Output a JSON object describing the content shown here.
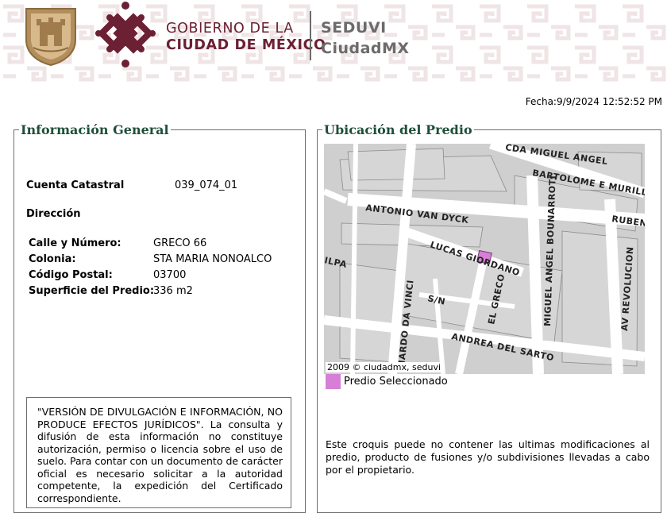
{
  "header": {
    "gobierno_line1": "GOBIERNO DE LA",
    "gobierno_line2": "CIUDAD DE MÉXICO",
    "seduvi_line1": "SEDUVI",
    "seduvi_line2": "CiudadMX",
    "brand_color": "#6b2034",
    "gray_color": "#6b6b6b"
  },
  "fecha": "Fecha:9/9/2024 12:52:52 PM",
  "info": {
    "legend": "Información General",
    "cuenta_label": "Cuenta Catastral",
    "cuenta_value": "039_074_01",
    "direccion_label": "Dirección",
    "calle_label": "Calle y Número:",
    "calle_value": "GRECO 66",
    "colonia_label": "Colonia:",
    "colonia_value": "STA MARIA NONOALCO",
    "cp_label": "Código Postal:",
    "cp_value": "03700",
    "superficie_label": "Superficie del Predio:",
    "superficie_value": "336 m2"
  },
  "disclaimer": "\"VERSIÓN DE DIVULGACIÓN E INFORMACIÓN, NO PRODUCE EFECTOS JURÍDICOS\". La consulta y difusión de esta información no constituye autorización, permiso o licencia sobre el uso de suelo. Para contar con un documento de carácter oficial es necesario solicitar a la autoridad competente, la expedición del Certificado correspondiente.",
  "ubicacion": {
    "legend": "Ubicación del Predio",
    "map_credit": "2009 © ciudadmx, seduvi",
    "predio_label": "Predio Seleccionado",
    "predio_color": "#d77fd6",
    "note": "Este croquis puede no contener las ultimas modificaciones al predio, producto de fusiones y/o subdivisiones llevadas a cabo por el propietario."
  },
  "map": {
    "streets": {
      "s1": "CDA MIGUEL ANGEL",
      "s2": "BARTOLOME E MURILLO",
      "s3": "RUBEN",
      "s4": "ANTONIO VAN DYCK",
      "s5": "LUCAS GIORDANO",
      "s6": "MIGUEL ANGEL BOUNARROTI",
      "s7": "AV REVOLUCION",
      "s8": "ILPA",
      "s9": "S/N",
      "s10": "NARDO DA VINCI",
      "s11": "EL GRECO",
      "s12": "ANDREA DEL SARTO"
    }
  }
}
